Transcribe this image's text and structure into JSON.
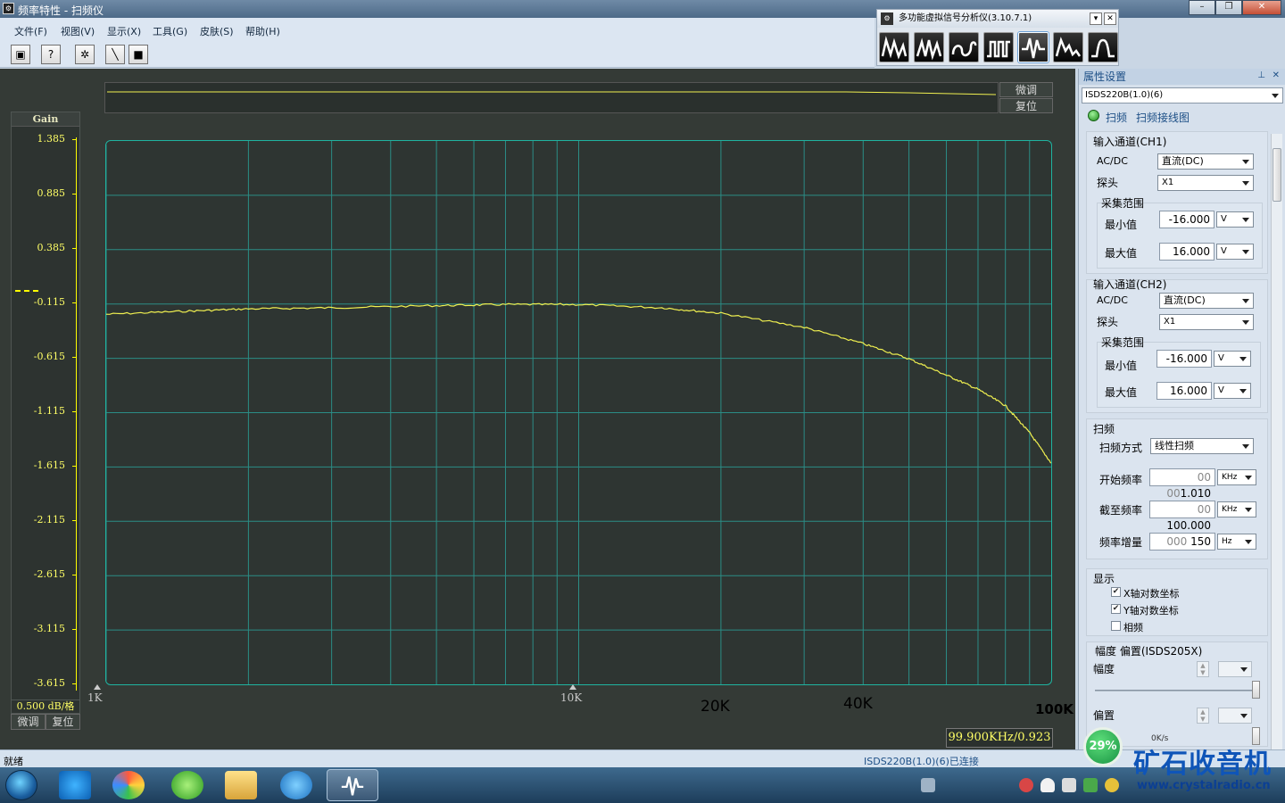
{
  "window": {
    "title": "频率特性 - 扫频仪"
  },
  "menu": [
    "文件(F)",
    "视图(V)",
    "显示(X)",
    "工具(G)",
    "皮肤(S)",
    "帮助(H)"
  ],
  "toolbar": {
    "icons": [
      "save-icon",
      "help-icon",
      "settings-icon",
      "draw-line-icon",
      "stop-icon"
    ]
  },
  "module_bar": {
    "title": "多功能虚拟信号分析仪(3.10.7.1)",
    "buttons": [
      "oscilloscope-icon",
      "spectrum-icon",
      "xy-plot-icon",
      "pulse-icon",
      "sweep-icon",
      "recorder-icon",
      "filter-icon"
    ],
    "active": "sweep-icon"
  },
  "strip": {
    "fine_tune": "微调",
    "reset": "复位"
  },
  "yaxis": {
    "label": "Gain",
    "ticks": [
      "1.385",
      "0.885",
      "0.385",
      "-0.115",
      "-0.615",
      "-1.115",
      "-1.615",
      "-2.115",
      "-2.615",
      "-3.115",
      "-3.615"
    ],
    "scale": "0.500  dB/格",
    "fine_tune": "微调",
    "reset": "复位"
  },
  "xaxis": {
    "small_labels": [
      "1K",
      "10K"
    ],
    "large_labels": [
      "20K",
      "40K",
      "100K"
    ]
  },
  "readout": "99.900KHz/0.923",
  "chart_data": {
    "type": "line",
    "x_scale": "log",
    "xlim": [
      1000,
      100000
    ],
    "ylim": [
      -3.615,
      1.385
    ],
    "x": [
      1000,
      1500,
      2000,
      3000,
      5000,
      7000,
      10000,
      15000,
      20000,
      30000,
      40000,
      50000,
      60000,
      70000,
      80000,
      90000,
      100000
    ],
    "y": [
      -0.21,
      -0.18,
      -0.16,
      -0.15,
      -0.13,
      -0.12,
      -0.12,
      -0.15,
      -0.2,
      -0.33,
      -0.48,
      -0.62,
      -0.77,
      -0.9,
      -1.05,
      -1.3,
      -1.58
    ],
    "series_color": "#f0f050",
    "grid": true
  },
  "panel": {
    "title": "属性设置",
    "device": "ISDS220B(1.0)(6)",
    "mode": "扫频",
    "mode_desc": "扫频接线图",
    "ch1": {
      "group": "输入通道(CH1)",
      "acdc_label": "AC/DC",
      "acdc": "直流(DC)",
      "probe_label": "探头",
      "probe": "X1",
      "range_group": "采集范围",
      "min_label": "最小值",
      "min": "-16.000",
      "min_unit": "V",
      "max_label": "最大值",
      "max": "16.000",
      "max_unit": "V"
    },
    "ch2": {
      "group": "输入通道(CH2)",
      "acdc_label": "AC/DC",
      "acdc": "直流(DC)",
      "probe_label": "探头",
      "probe": "X1",
      "range_group": "采集范围",
      "min_label": "最小值",
      "min": "-16.000",
      "min_unit": "V",
      "max_label": "最大值",
      "max": "16.000",
      "max_unit": "V"
    },
    "sweep": {
      "group": "扫频",
      "mode_label": "扫频方式",
      "mode": "线性扫频",
      "start_label": "开始频率",
      "start_prefix": "00 00",
      "start": "1.010",
      "start_unit": "KHz",
      "stop_label": "截至频率",
      "stop_prefix": "00 ",
      "stop": "100.000",
      "stop_unit": "KHz",
      "step_label": "频率增量",
      "step_prefix": "000 ",
      "step": "150",
      "step_unit": "Hz"
    },
    "display": {
      "group": "显示",
      "x_log": "X轴对数坐标",
      "x_log_checked": true,
      "y_log": "Y轴对数坐标",
      "y_log_checked": true,
      "phase": "相频",
      "phase_checked": false
    },
    "amp": {
      "group": "幅度 偏置(ISDS205X)",
      "amp_label": "幅度",
      "offset_label": "偏置"
    }
  },
  "status": {
    "left": "就绪",
    "right": "ISDS220B(1.0)(6)已连接"
  },
  "gauge": {
    "value": "29%",
    "speed": "0K/s"
  },
  "watermark": {
    "line1": "矿石收音机",
    "line2": "www.crystalradio.cn"
  }
}
